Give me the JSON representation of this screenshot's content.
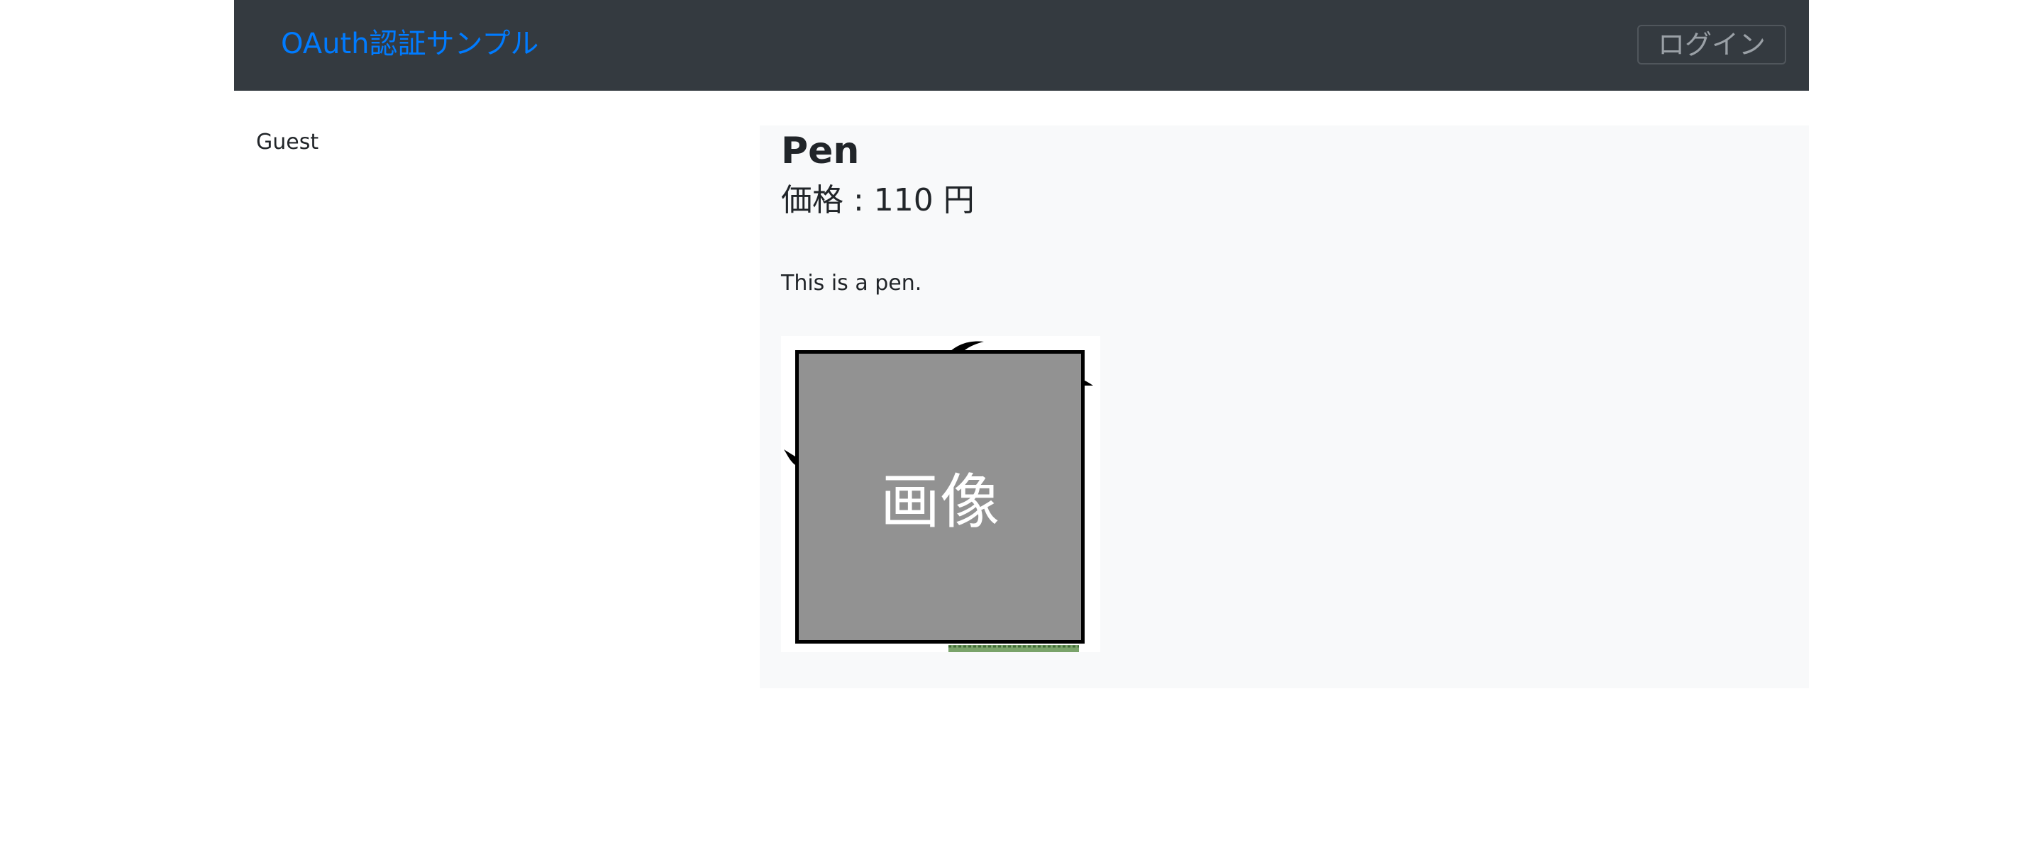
{
  "header": {
    "brand": "OAuth認証サンプル",
    "login_label": "ログイン"
  },
  "sidebar": {
    "user_name": "Guest"
  },
  "product": {
    "name": "Pen",
    "price_text": "価格 : 110 円",
    "description": "This is a pen.",
    "image_placeholder": "画像"
  },
  "colors": {
    "navbar_bg": "#343a40",
    "brand_link": "#007bff",
    "card_bg": "#f8f9fa",
    "placeholder_bg": "#929292"
  }
}
